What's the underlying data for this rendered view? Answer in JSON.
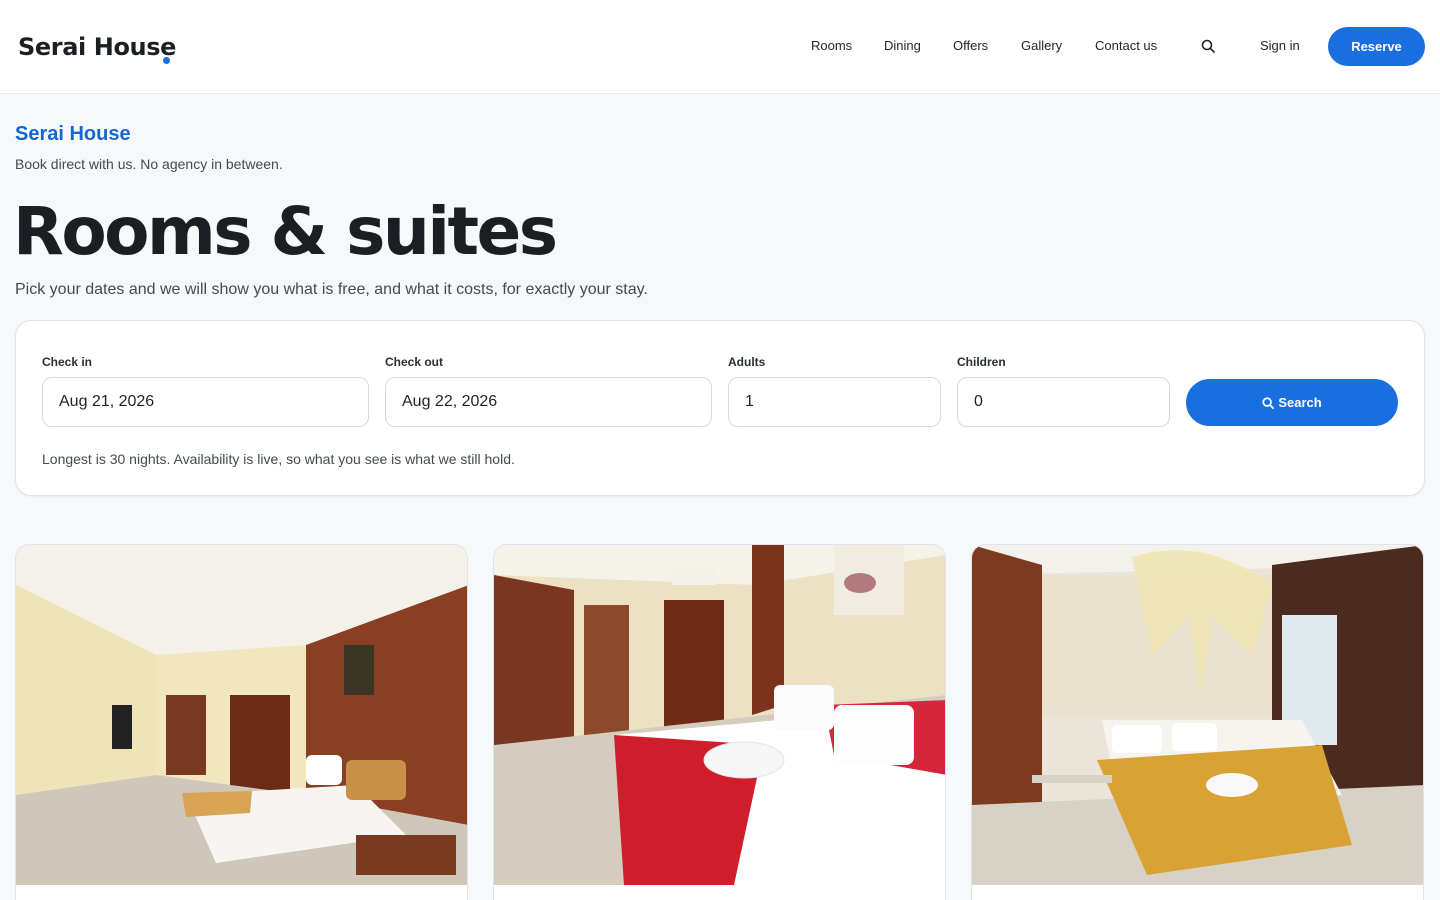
{
  "header": {
    "brand": "Serai House",
    "nav": [
      "Rooms",
      "Dining",
      "Offers",
      "Gallery",
      "Contact us"
    ],
    "sign_in": "Sign in",
    "reserve": "Reserve"
  },
  "hero": {
    "eyebrow": "Serai House",
    "tagline": "Book direct with us. No agency in between.",
    "title": "Rooms & suites",
    "subtitle": "Pick your dates and we will show you what is free, and what it costs, for exactly your stay."
  },
  "search": {
    "check_in_label": "Check in",
    "check_in_value": "Aug 21, 2026",
    "check_out_label": "Check out",
    "check_out_value": "Aug 22, 2026",
    "adults_label": "Adults",
    "adults_value": "1",
    "children_label": "Children",
    "children_value": "0",
    "button": "Search",
    "note": "Longest is 30 nights. Availability is live, so what you see is what we still hold."
  },
  "rooms": [
    {
      "photo": "room-photo-1"
    },
    {
      "photo": "room-photo-2"
    },
    {
      "photo": "room-photo-3"
    }
  ],
  "colors": {
    "accent": "#1a6fe0",
    "eyebrow": "#1566cf"
  }
}
